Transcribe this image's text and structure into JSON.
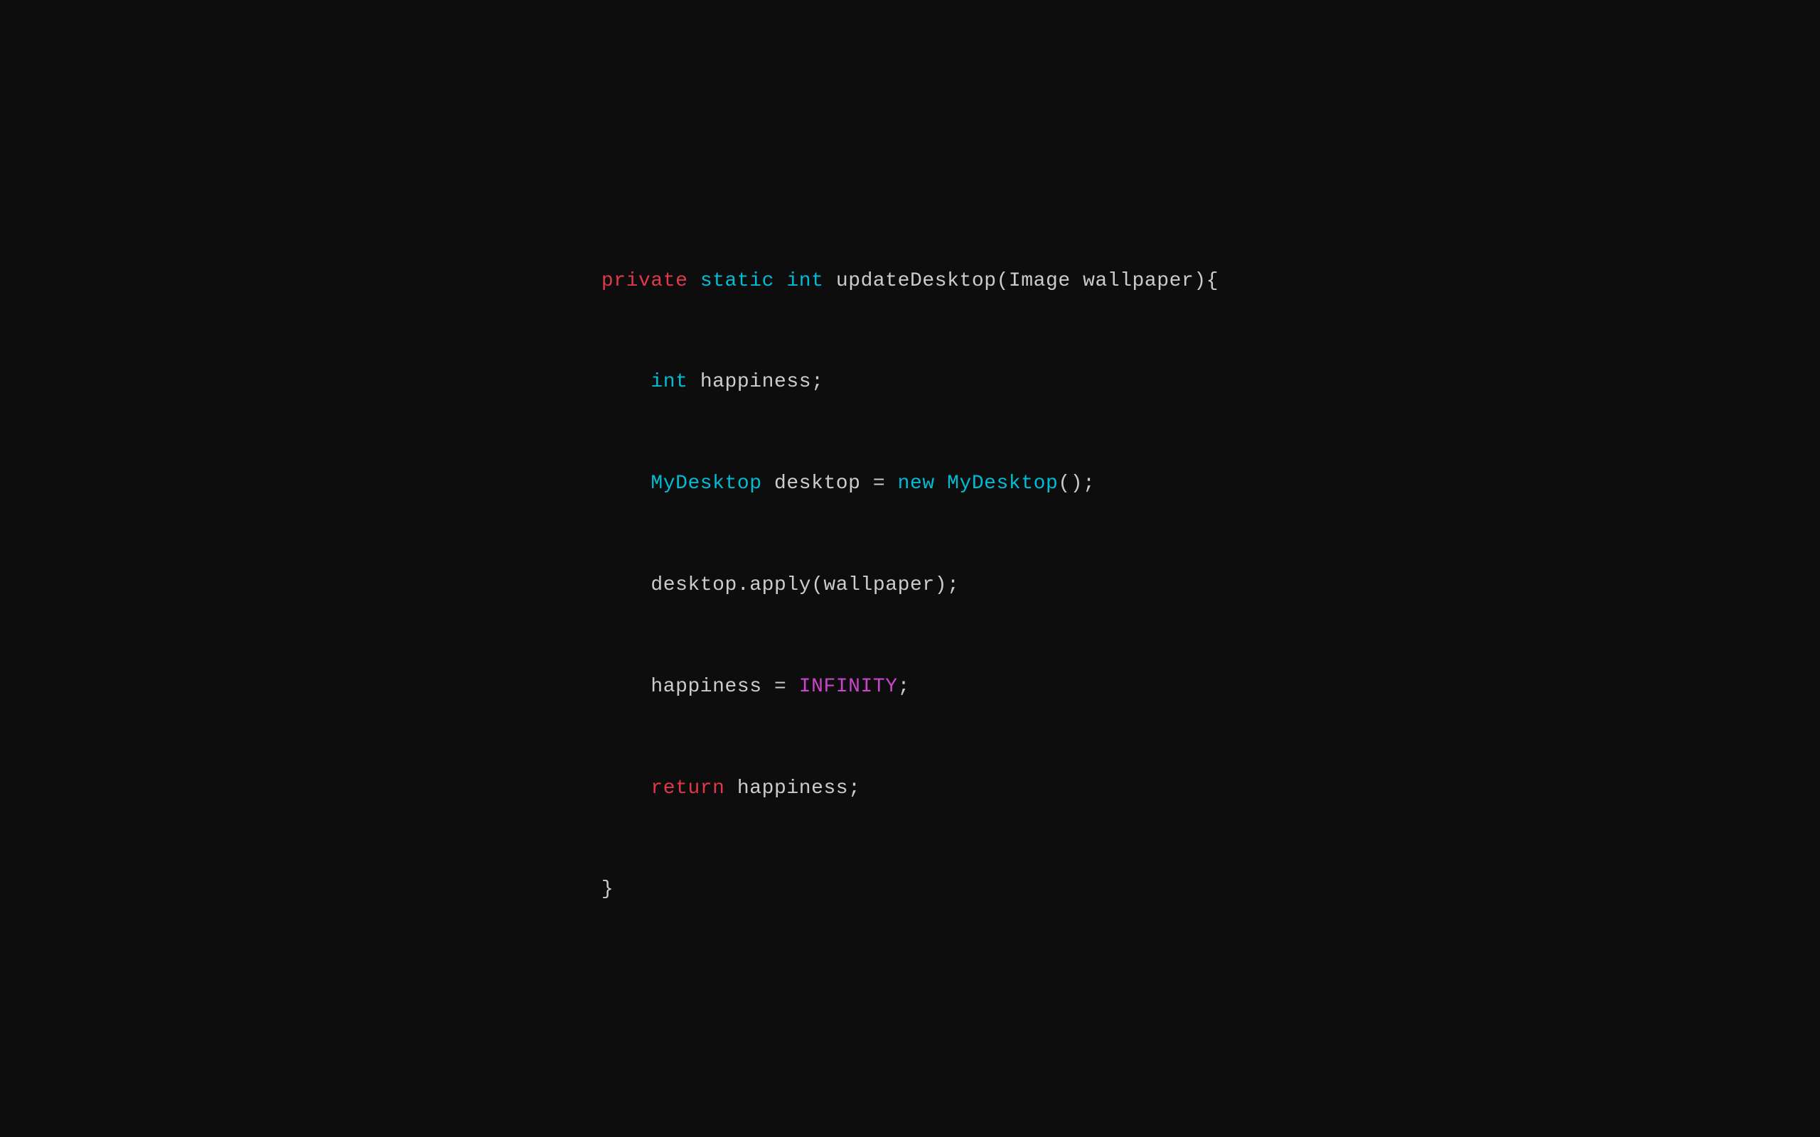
{
  "background": "#0d0d0d",
  "code": {
    "line1": {
      "private": "private",
      "space1": " ",
      "static": "static",
      "space2": " ",
      "int": "int",
      "rest": " updateDesktop(Image wallpaper){"
    },
    "line2": {
      "indent": "    ",
      "int": "int",
      "rest": " happiness;"
    },
    "line3": {
      "indent": "    ",
      "mydesktop1": "MyDesktop",
      "rest": " desktop = ",
      "new": "new",
      "space": " ",
      "mydesktop2": "MyDesktop",
      "rest2": "();"
    },
    "line4": {
      "indent": "    ",
      "rest": "desktop.apply(wallpaper);"
    },
    "line5": {
      "indent": "    ",
      "rest1": "happiness = ",
      "infinity": "INFINITY",
      "rest2": ";"
    },
    "line6": {
      "indent": "    ",
      "return": "return",
      "rest": " happiness;"
    },
    "line7": {
      "brace": "}"
    }
  }
}
